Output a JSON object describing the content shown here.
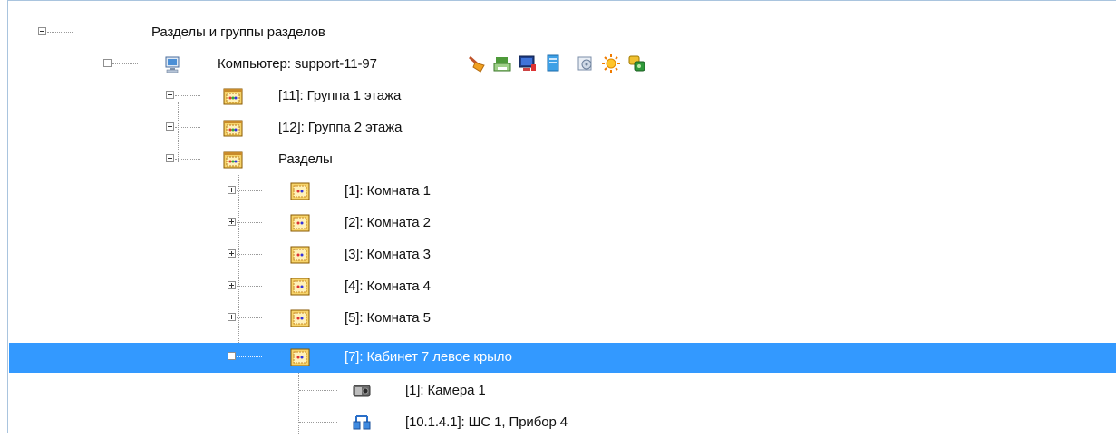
{
  "tree": {
    "root": {
      "label": "Разделы и группы разделов"
    },
    "computer": {
      "label": "Компьютер: support-11-97",
      "status_icons": [
        "broom-icon",
        "printer-icon",
        "monitor-icon",
        "document-icon",
        "disk-icon",
        "sun-icon",
        "keys-icon"
      ]
    },
    "groups": [
      {
        "label": "[11]: Группа 1 этажа"
      },
      {
        "label": "[12]: Группа 2 этажа"
      }
    ],
    "sections": {
      "label": "Разделы"
    },
    "rooms": [
      {
        "label": "[1]: Комната 1"
      },
      {
        "label": "[2]: Комната 2"
      },
      {
        "label": "[3]: Комната 3"
      },
      {
        "label": "[4]: Комната 4"
      },
      {
        "label": "[5]: Комната 5"
      }
    ],
    "selected_room": {
      "label": "[7]: Кабинет 7 левое крыло"
    },
    "children": [
      {
        "label": "[1]: Камера 1"
      },
      {
        "label": "[10.1.4.1]: ШС 1, Прибор 4"
      }
    ]
  },
  "colors": {
    "selection": "#3399ff",
    "border": "#a9c4de"
  }
}
